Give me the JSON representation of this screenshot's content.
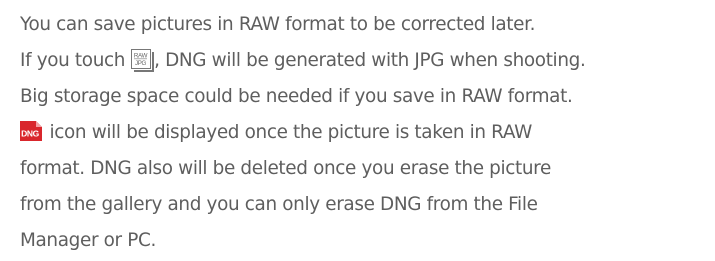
{
  "paragraph": {
    "line1": "You can save pictures in RAW format to be corrected later.",
    "line2_before": "If you touch",
    "line2_after": ", DNG will be generated with JPG when shooting.",
    "line3": "Big storage space could be needed if you save in RAW format.",
    "line4_after": "icon will be displayed once the picture is taken in RAW",
    "line5": "format. DNG also will be deleted once you erase the picture",
    "line6": "from the gallery and you can only erase DNG from the File",
    "line7": "Manager or PC."
  },
  "icons": {
    "raw_jpg": {
      "name": "raw-jpg-icon",
      "top_text": "RAW",
      "bottom_text": "JPG"
    },
    "dng": {
      "name": "dng-file-icon",
      "text": "DNG",
      "color": "#d9262c"
    }
  }
}
